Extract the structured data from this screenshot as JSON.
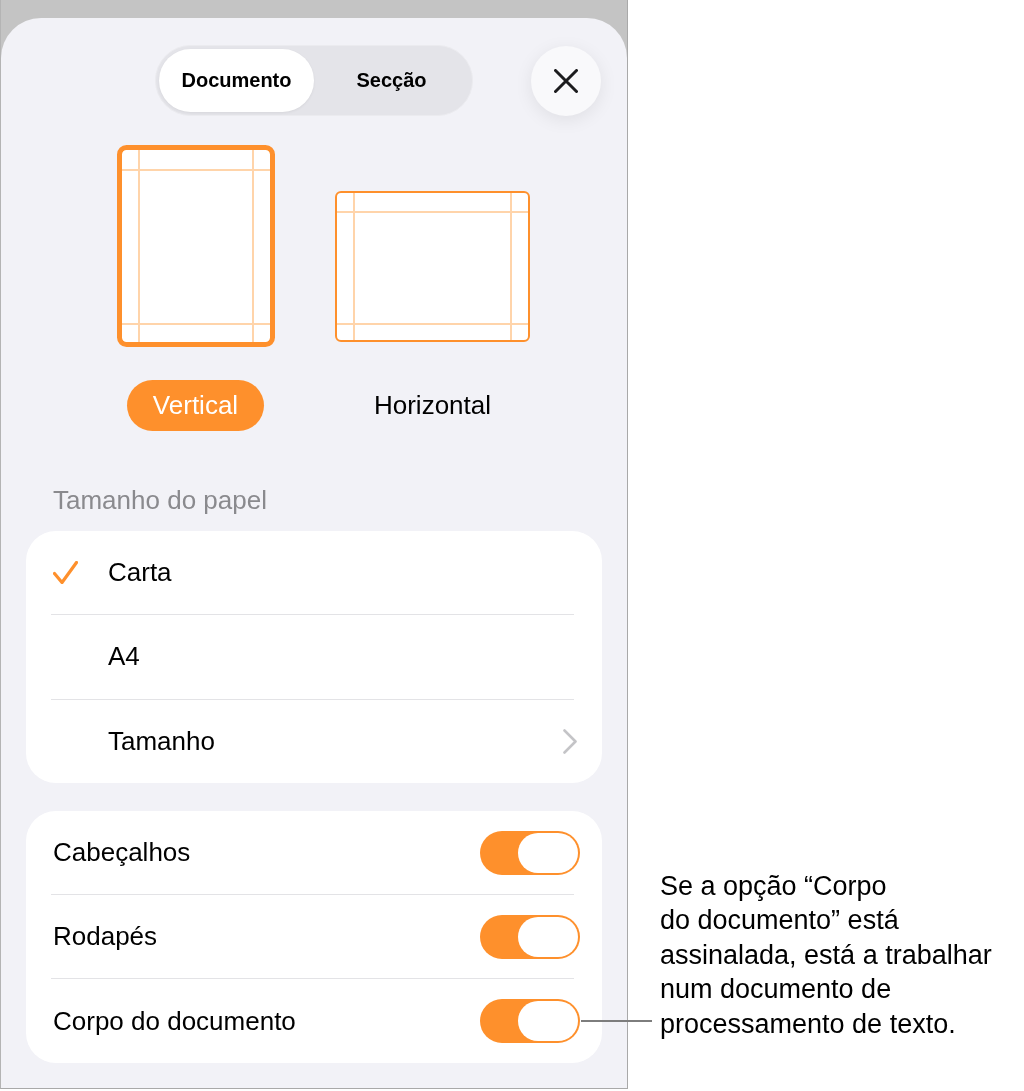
{
  "segmented_control": [
    {
      "label": "Documento",
      "selected": true
    },
    {
      "label": "Secção",
      "selected": false
    }
  ],
  "orientation": [
    {
      "kind": "portrait",
      "label": "Vertical",
      "selected": true
    },
    {
      "kind": "landscape",
      "label": "Horizontal",
      "selected": false
    }
  ],
  "paper_size": {
    "title": "Tamanho do papel",
    "items": [
      {
        "kind": "option",
        "label": "Carta",
        "selected": true
      },
      {
        "kind": "option",
        "label": "A4",
        "selected": false
      },
      {
        "kind": "link",
        "label": "Tamanho",
        "selected": false
      }
    ]
  },
  "sections": [
    {
      "label": "Cabeçalhos",
      "on": true
    },
    {
      "label": "Rodapés",
      "on": true
    },
    {
      "label": "Corpo do documento",
      "on": true
    }
  ],
  "callout": {
    "text": "Se a opção “Corpo\ndo documento” está\nassinalada, está a trabalhar\nnum documento de\nprocessamento de texto."
  }
}
